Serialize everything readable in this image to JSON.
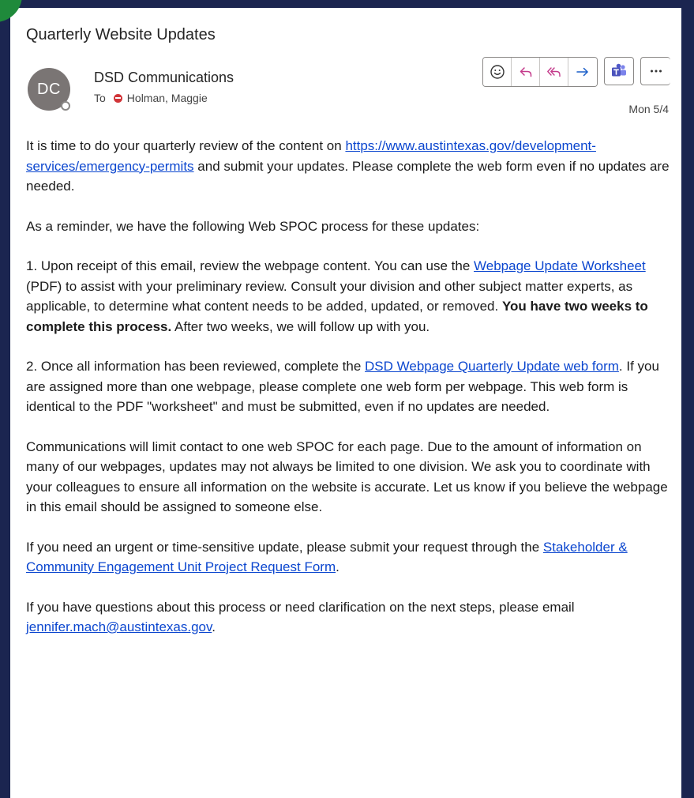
{
  "email": {
    "subject": "Quarterly Website Updates",
    "sender": {
      "initials": "DC",
      "name": "DSD Communications"
    },
    "to_label": "To",
    "recipient": "Holman, Maggie",
    "date": "Mon 5/4"
  },
  "toolbar": {
    "icons": [
      "emoji-icon",
      "reply-icon",
      "reply-all-icon",
      "forward-icon",
      "teams-icon",
      "more-icon"
    ]
  },
  "colors": {
    "background": "#1b2550",
    "link": "#0b46cf",
    "busy": "#d13438",
    "teams": "#5059c9",
    "reply_all": "#c43a8b",
    "corner_badge": "#1f8a3b"
  },
  "body": {
    "p1_before": "It is time to do your quarterly review of the content on ",
    "p1_link": "https://www.austintexas.gov/development-services/emergency-permits",
    "p1_after": " and submit your updates. Please complete the web form even if no updates are needed.",
    "p2": "As a reminder, we have the following Web SPOC process for these updates:",
    "p3_before": "1. Upon receipt of this email, review the webpage content. You can use the ",
    "p3_link": "Webpage Update Worksheet",
    "p3_middle": " (PDF) to assist with your preliminary review. Consult your division and other subject matter experts, as applicable, to determine what content needs to be added, updated, or removed. ",
    "p3_bold": "You have two weeks to complete this process.",
    "p3_after": " After two weeks, we will follow up with you.",
    "p4_before": "2. Once all information has been reviewed, complete the ",
    "p4_link": "DSD Webpage Quarterly Update web form",
    "p4_after": ". If you are assigned more than one webpage, please complete one web form per webpage. This web form is identical to the PDF \"worksheet\" and must be submitted, even if no updates are needed.",
    "p5": "Communications will limit contact to one web SPOC for each page. Due to the amount of information on many of our webpages, updates may not always be limited to one division. We ask you to coordinate with your colleagues to ensure all information on the website is accurate. Let us know if you believe the webpage in this email should be assigned to someone else.",
    "p6_before": "If you need an urgent or time-sensitive update, please submit your request through the ",
    "p6_link": "Stakeholder & Community Engagement Unit Project Request Form",
    "p6_after": ".",
    "p7_before": "If you have questions about this process or need clarification on the next steps, please email ",
    "p7_link": "jennifer.mach@austintexas.gov",
    "p7_after": "."
  }
}
